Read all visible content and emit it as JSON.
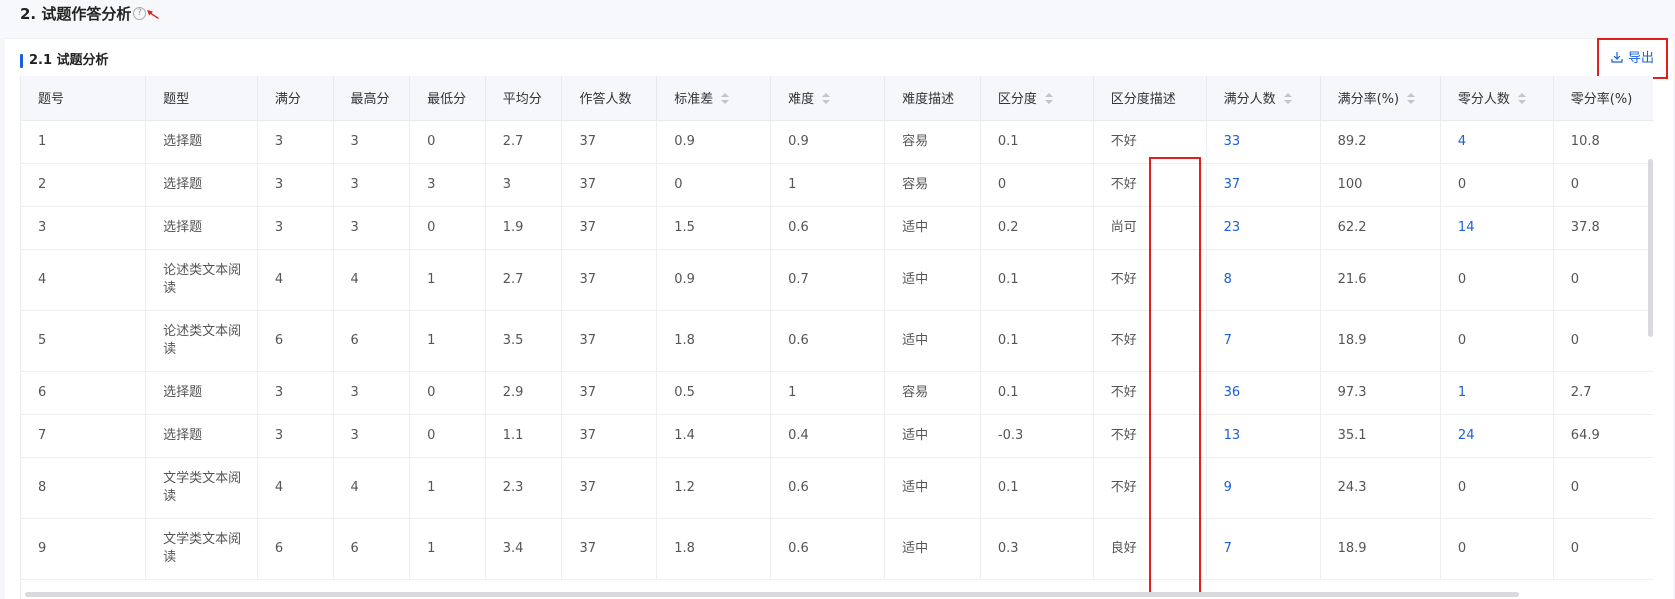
{
  "section": {
    "title": "2. 试题作答分析",
    "help_icon": "question-circle-icon"
  },
  "subsection": {
    "title": "2.1 试题分析"
  },
  "toolbar": {
    "export_label": "导出",
    "export_icon": "download-icon"
  },
  "table": {
    "columns": [
      {
        "label": "题号",
        "sortable": false
      },
      {
        "label": "题型",
        "sortable": false
      },
      {
        "label": "满分",
        "sortable": false
      },
      {
        "label": "最高分",
        "sortable": false
      },
      {
        "label": "最低分",
        "sortable": false
      },
      {
        "label": "平均分",
        "sortable": false
      },
      {
        "label": "作答人数",
        "sortable": false
      },
      {
        "label": "标准差",
        "sortable": true
      },
      {
        "label": "难度",
        "sortable": true
      },
      {
        "label": "难度描述",
        "sortable": false
      },
      {
        "label": "区分度",
        "sortable": true
      },
      {
        "label": "区分度描述",
        "sortable": false
      },
      {
        "label": "满分人数",
        "sortable": true
      },
      {
        "label": "满分率(%)",
        "sortable": true
      },
      {
        "label": "零分人数",
        "sortable": true
      },
      {
        "label": "零分率(%)",
        "sortable": false
      }
    ],
    "rows": [
      [
        "1",
        "选择题",
        "3",
        "3",
        "0",
        "2.7",
        "37",
        "0.9",
        "0.9",
        "容易",
        "0.1",
        "不好",
        "33",
        "89.2",
        "4",
        "10.8"
      ],
      [
        "2",
        "选择题",
        "3",
        "3",
        "3",
        "3",
        "37",
        "0",
        "1",
        "容易",
        "0",
        "不好",
        "37",
        "100",
        "0",
        "0"
      ],
      [
        "3",
        "选择题",
        "3",
        "3",
        "0",
        "1.9",
        "37",
        "1.5",
        "0.6",
        "适中",
        "0.2",
        "尚可",
        "23",
        "62.2",
        "14",
        "37.8"
      ],
      [
        "4",
        "论述类文本阅读",
        "4",
        "4",
        "1",
        "2.7",
        "37",
        "0.9",
        "0.7",
        "适中",
        "0.1",
        "不好",
        "8",
        "21.6",
        "0",
        "0"
      ],
      [
        "5",
        "论述类文本阅读",
        "6",
        "6",
        "1",
        "3.5",
        "37",
        "1.8",
        "0.6",
        "适中",
        "0.1",
        "不好",
        "7",
        "18.9",
        "0",
        "0"
      ],
      [
        "6",
        "选择题",
        "3",
        "3",
        "0",
        "2.9",
        "37",
        "0.5",
        "1",
        "容易",
        "0.1",
        "不好",
        "36",
        "97.3",
        "1",
        "2.7"
      ],
      [
        "7",
        "选择题",
        "3",
        "3",
        "0",
        "1.1",
        "37",
        "1.4",
        "0.4",
        "适中",
        "-0.3",
        "不好",
        "13",
        "35.1",
        "24",
        "64.9"
      ],
      [
        "8",
        "文学类文本阅读",
        "4",
        "4",
        "1",
        "2.3",
        "37",
        "1.2",
        "0.6",
        "适中",
        "0.1",
        "不好",
        "9",
        "24.3",
        "0",
        "0"
      ],
      [
        "9",
        "文学类文本阅读",
        "6",
        "6",
        "1",
        "3.4",
        "37",
        "1.8",
        "0.6",
        "适中",
        "0.3",
        "良好",
        "7",
        "18.9",
        "0",
        "0"
      ]
    ]
  },
  "colors": {
    "accent": "#1a5fdb",
    "highlight": "#e0201c"
  }
}
